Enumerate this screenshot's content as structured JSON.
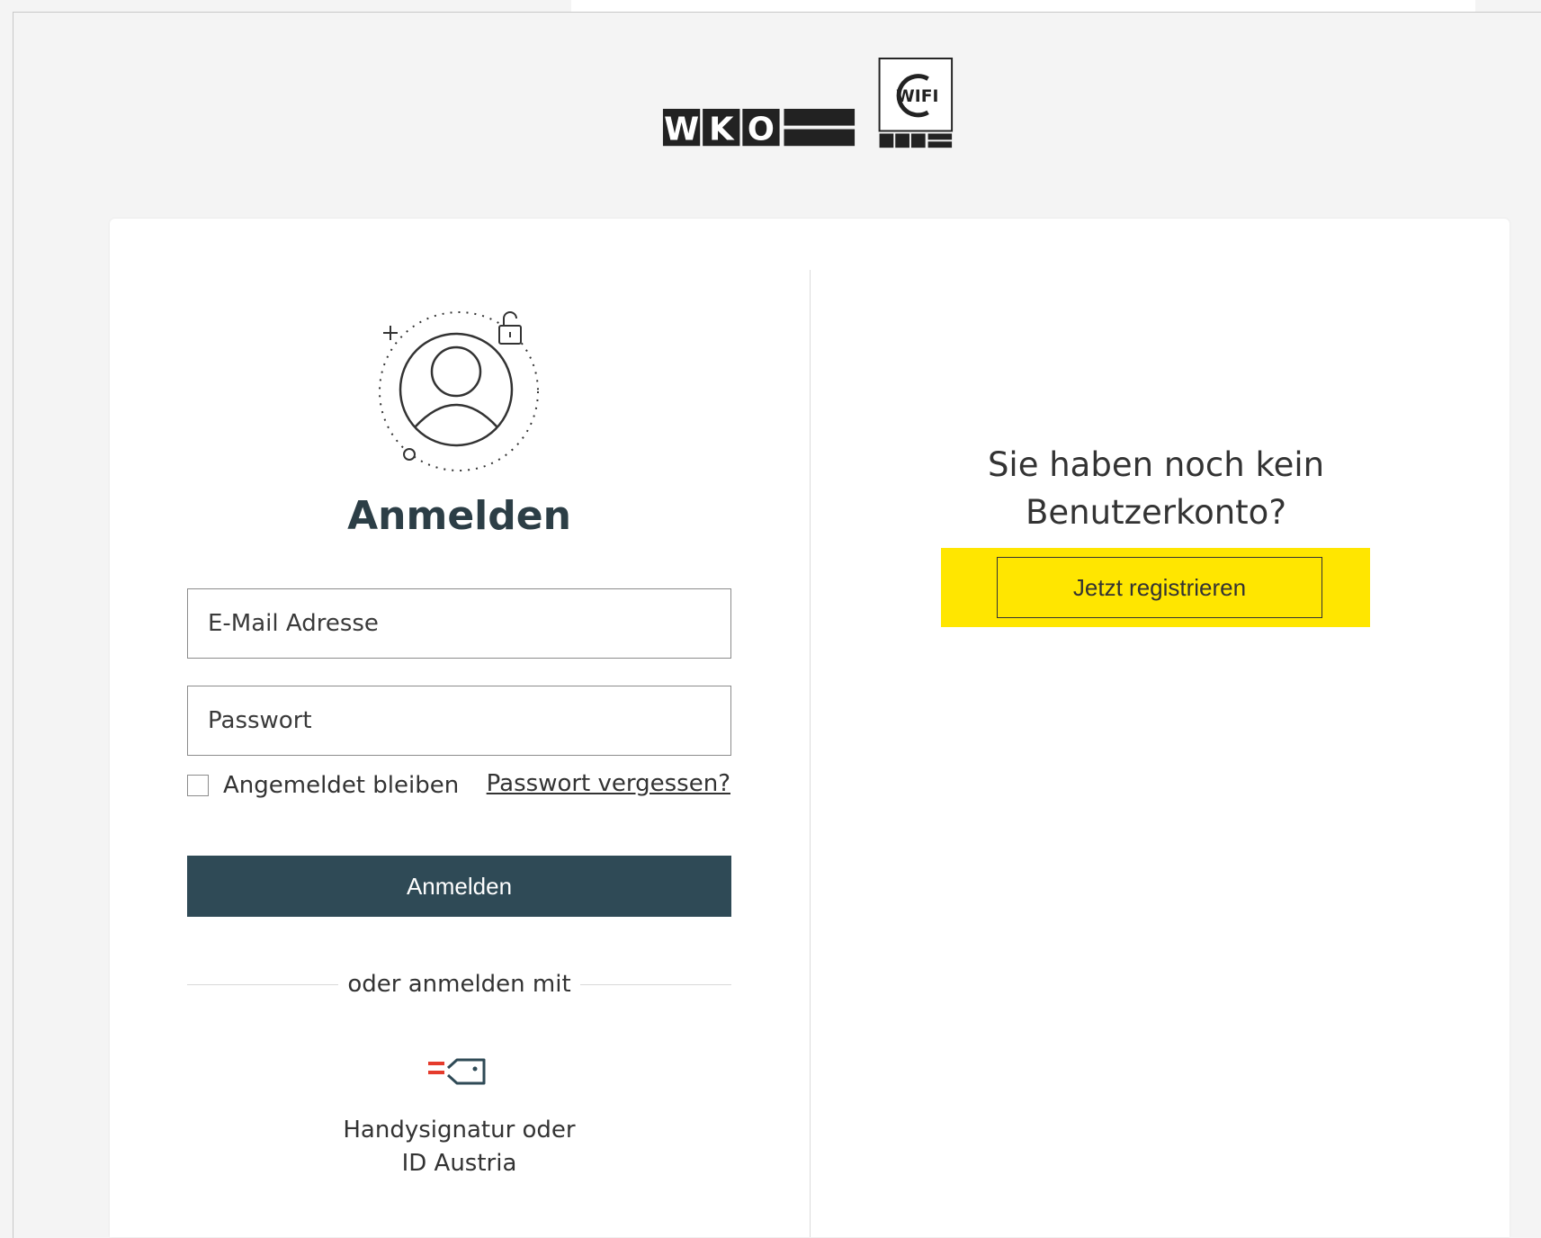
{
  "header": {
    "logo_wko_text": "WKO",
    "logo_wifi_text": "WIFI",
    "logo_wifi_sub_text": "WKO"
  },
  "login": {
    "title": "Anmelden",
    "email_placeholder": "E-Mail Adresse",
    "password_placeholder": "Passwort",
    "remember_label": "Angemeldet bleiben",
    "forgot_label": "Passwort vergessen?",
    "submit_label": "Anmelden",
    "or_label": "oder anmelden mit",
    "handysignatur_line1": "Handysignatur oder",
    "handysignatur_line2": "ID Austria"
  },
  "register": {
    "line1": "Sie haben noch kein",
    "line2": "Benutzerkonto?",
    "button_label": "Jetzt registrieren"
  },
  "colors": {
    "primary_button": "#2f4a56",
    "highlight": "#ffe600",
    "page_background": "#f4f4f4",
    "austria_red": "#e53b2c"
  }
}
